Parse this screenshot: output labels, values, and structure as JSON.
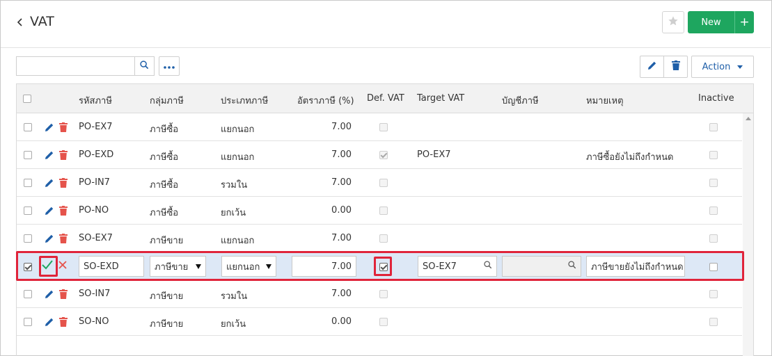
{
  "header": {
    "title": "VAT",
    "new_label": "New"
  },
  "toolbar": {
    "search_value": "",
    "action_label": "Action"
  },
  "columns": [
    "รหัสภาษี",
    "กลุ่มภาษี",
    "ประเภทภาษี",
    "อัตราภาษี (%)",
    "Def. VAT",
    "Target VAT",
    "บัญชีภาษี",
    "หมายเหตุ",
    "Inactive"
  ],
  "rows": [
    {
      "code": "PO-EX7",
      "group": "ภาษีซื้อ",
      "type": "แยกนอก",
      "rate": "7.00",
      "def_vat": false,
      "target": "",
      "account": "",
      "note": "",
      "inactive": false
    },
    {
      "code": "PO-EXD",
      "group": "ภาษีซื้อ",
      "type": "แยกนอก",
      "rate": "7.00",
      "def_vat": true,
      "target": "PO-EX7",
      "account": "",
      "note": "ภาษีซื้อยังไม่ถึงกำหนด",
      "inactive": false
    },
    {
      "code": "PO-IN7",
      "group": "ภาษีซื้อ",
      "type": "รวมใน",
      "rate": "7.00",
      "def_vat": false,
      "target": "",
      "account": "",
      "note": "",
      "inactive": false
    },
    {
      "code": "PO-NO",
      "group": "ภาษีซื้อ",
      "type": "ยกเว้น",
      "rate": "0.00",
      "def_vat": false,
      "target": "",
      "account": "",
      "note": "",
      "inactive": false
    },
    {
      "code": "SO-EX7",
      "group": "ภาษีขาย",
      "type": "แยกนอก",
      "rate": "7.00",
      "def_vat": false,
      "target": "",
      "account": "",
      "note": "",
      "inactive": false
    }
  ],
  "edit_row": {
    "code": "SO-EXD",
    "group": "ภาษีขาย",
    "type": "แยกนอก",
    "rate": "7.00",
    "def_vat": true,
    "target": "SO-EX7",
    "account": "",
    "note": "ภาษีขายยังไม่ถึงกำหนด",
    "inactive": false,
    "selected": true
  },
  "rows_after": [
    {
      "code": "SO-IN7",
      "group": "ภาษีขาย",
      "type": "รวมใน",
      "rate": "7.00",
      "def_vat": false,
      "target": "",
      "account": "",
      "note": "",
      "inactive": false
    },
    {
      "code": "SO-NO",
      "group": "ภาษีขาย",
      "type": "ยกเว้น",
      "rate": "0.00",
      "def_vat": false,
      "target": "",
      "account": "",
      "note": "",
      "inactive": false
    }
  ],
  "colors": {
    "accent": "#1ea65f",
    "link": "#1f5fa8",
    "delete": "#e5534b",
    "highlight": "#e0243a",
    "edit_row_bg": "#dde8f6"
  }
}
